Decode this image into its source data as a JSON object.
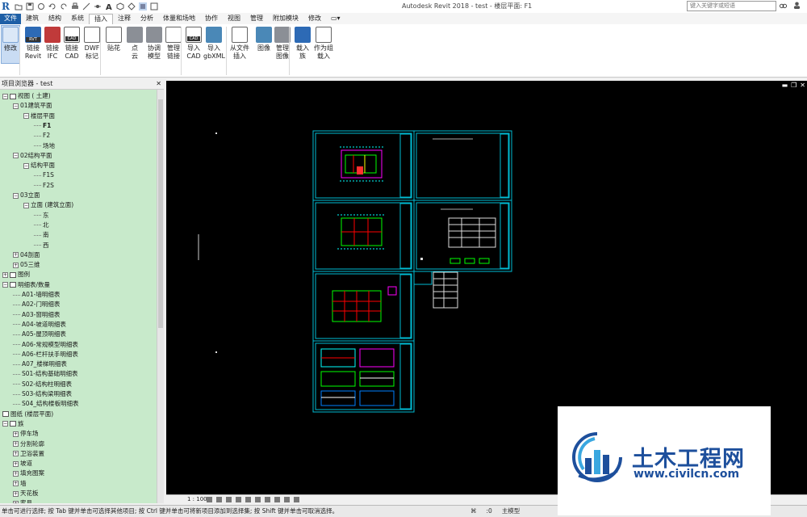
{
  "app": {
    "title": "Autodesk Revit 2018 -    test - 楼层平面: F1",
    "logo": "R",
    "search_placeholder": "键入关键字或短语"
  },
  "ribbon": {
    "tabs": [
      "文件",
      "建筑",
      "结构",
      "系统",
      "插入",
      "注释",
      "分析",
      "体量和场地",
      "协作",
      "视图",
      "管理",
      "附加模块",
      "修改"
    ],
    "active_tab": "插入",
    "buttons": [
      {
        "l1": "修改",
        "l2": "",
        "icon": "cursor-icon"
      },
      {
        "l1": "链接",
        "l2": "Revit",
        "icon": "link-revit-icon",
        "tag": "RVT"
      },
      {
        "l1": "链接",
        "l2": "IFC",
        "icon": "link-ifc-icon"
      },
      {
        "l1": "链接",
        "l2": "CAD",
        "icon": "link-cad-icon",
        "tag": "CAD"
      },
      {
        "l1": "DWF",
        "l2": "标记",
        "icon": "dwf-markup-icon"
      },
      {
        "l1": "贴花",
        "l2": "",
        "icon": "decal-icon"
      },
      {
        "l1": "点",
        "l2": "云",
        "icon": "point-cloud-icon"
      },
      {
        "l1": "协调",
        "l2": "模型",
        "icon": "coordination-model-icon"
      },
      {
        "l1": "管理",
        "l2": "链接",
        "icon": "manage-links-icon"
      },
      {
        "l1": "导入",
        "l2": "CAD",
        "icon": "import-cad-icon",
        "tag": "CAD"
      },
      {
        "l1": "导入",
        "l2": "gbXML",
        "icon": "import-gbxml-icon"
      },
      {
        "l1": "从文件",
        "l2": "插入",
        "icon": "insert-from-file-icon"
      },
      {
        "l1": "图像",
        "l2": "",
        "icon": "image-icon"
      },
      {
        "l1": "管理",
        "l2": "图像",
        "icon": "manage-images-icon"
      },
      {
        "l1": "载入",
        "l2": "族",
        "icon": "load-family-icon"
      },
      {
        "l1": "作为组",
        "l2": "载入",
        "icon": "load-as-group-icon"
      }
    ]
  },
  "project_browser": {
    "title": "项目浏览器 - test",
    "rows": [
      {
        "text": "视图 (          土建)",
        "indent": 0,
        "exp": "−",
        "icon": true
      },
      {
        "text": "01建筑平面",
        "indent": 1,
        "exp": "−"
      },
      {
        "text": "楼层平面",
        "indent": 2,
        "exp": "−"
      },
      {
        "text": "F1",
        "indent": 3,
        "bold": true
      },
      {
        "text": "F2",
        "indent": 3
      },
      {
        "text": "场地",
        "indent": 3
      },
      {
        "text": "02结构平面",
        "indent": 1,
        "exp": "−"
      },
      {
        "text": "结构平面",
        "indent": 2,
        "exp": "−"
      },
      {
        "text": "F1S",
        "indent": 3
      },
      {
        "text": "F2S",
        "indent": 3
      },
      {
        "text": "03立面",
        "indent": 1,
        "exp": "−"
      },
      {
        "text": "立面 (建筑立面)",
        "indent": 2,
        "exp": "−"
      },
      {
        "text": "东",
        "indent": 3
      },
      {
        "text": "北",
        "indent": 3
      },
      {
        "text": "南",
        "indent": 3
      },
      {
        "text": "西",
        "indent": 3
      },
      {
        "text": "04剖面",
        "indent": 1,
        "exp": "+"
      },
      {
        "text": "05三维",
        "indent": 1,
        "exp": "+"
      },
      {
        "text": "图例",
        "indent": 0,
        "exp": "+",
        "icon": true
      },
      {
        "text": "明细表/数量",
        "indent": 0,
        "exp": "−",
        "icon": true
      },
      {
        "text": "A01-墙明细表",
        "indent": 1
      },
      {
        "text": "A02-门明细表",
        "indent": 1
      },
      {
        "text": "A03-窗明细表",
        "indent": 1
      },
      {
        "text": "A04-坡道明细表",
        "indent": 1
      },
      {
        "text": "A05-屋顶明细表",
        "indent": 1
      },
      {
        "text": "A06-常规模型明细表",
        "indent": 1
      },
      {
        "text": "A06-栏杆扶手明细表",
        "indent": 1
      },
      {
        "text": "A07_楼梯明细表",
        "indent": 1
      },
      {
        "text": "S01-结构基础明细表",
        "indent": 1
      },
      {
        "text": "S02-结构柱明细表",
        "indent": 1
      },
      {
        "text": "S03-结构梁明细表",
        "indent": 1
      },
      {
        "text": "S04_结构楼板明细表",
        "indent": 1
      },
      {
        "text": "图纸 (楼层平面)",
        "indent": 0,
        "icon": true
      },
      {
        "text": "族",
        "indent": 0,
        "exp": "−",
        "icon": true
      },
      {
        "text": "停车场",
        "indent": 1,
        "exp": "+"
      },
      {
        "text": "分割轮廓",
        "indent": 1,
        "exp": "+"
      },
      {
        "text": "卫浴装置",
        "indent": 1,
        "exp": "+"
      },
      {
        "text": "坡道",
        "indent": 1,
        "exp": "+"
      },
      {
        "text": "填充图案",
        "indent": 1,
        "exp": "+"
      },
      {
        "text": "墙",
        "indent": 1,
        "exp": "+"
      },
      {
        "text": "天花板",
        "indent": 1,
        "exp": "+"
      },
      {
        "text": "家具",
        "indent": 1,
        "exp": "+"
      }
    ]
  },
  "view_control": {
    "scale": "1 : 100"
  },
  "status_bar": {
    "text": "单击可进行选择; 按 Tab 键并单击可选择其他项目; 按 Ctrl 键并单击可将新项目添加到选择集; 按 Shift 键并单击可取消选择。",
    "model": "主模型",
    "filter": ":0"
  },
  "watermark": {
    "cn": "土木工程网",
    "url": "www.civilcn.com"
  },
  "colors": {
    "browser_bg": "#c8eacb",
    "sheet_border": "#00bcd4",
    "accent": "#1e5fa6"
  }
}
